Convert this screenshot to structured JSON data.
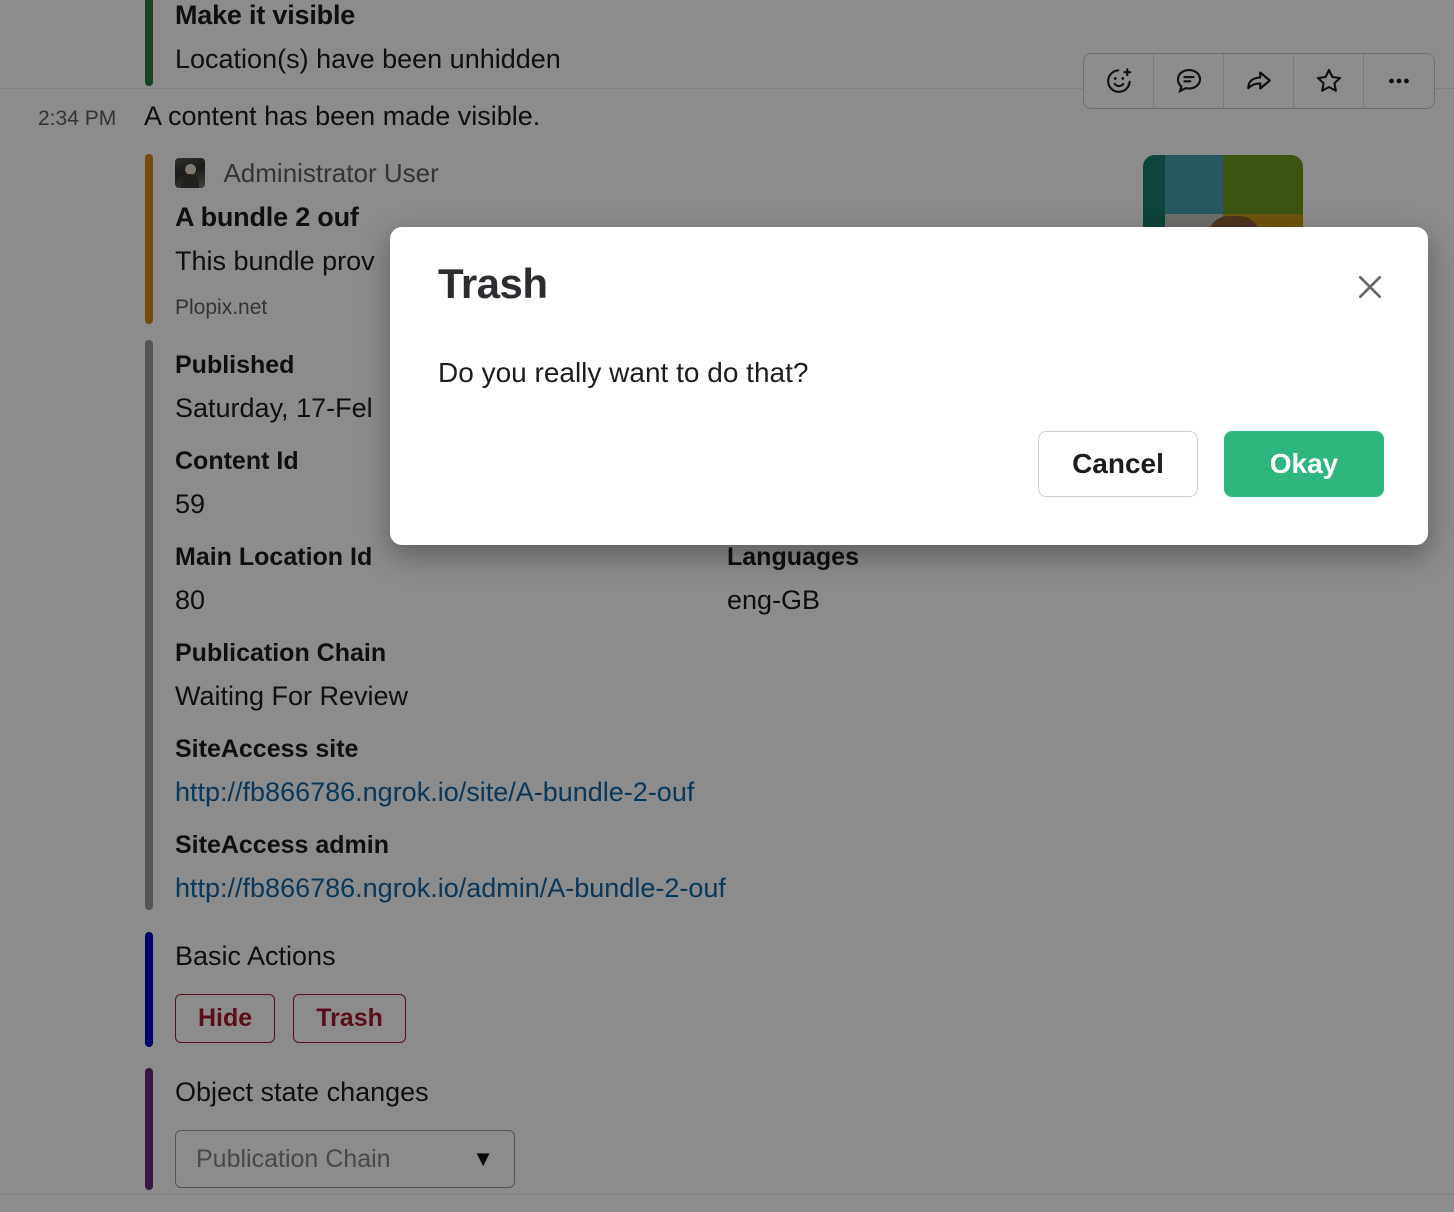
{
  "messages": {
    "unhidden_notice": {
      "title": "Make it visible",
      "text": "Location(s) have been unhidden",
      "accent_color": "#2a7a3b"
    },
    "system_line": {
      "timestamp": "2:34 PM",
      "text": "A content has been made visible."
    },
    "bundle_attachment": {
      "author": "Administrator User",
      "title": "A bundle 2 ouf",
      "description": "This bundle prov",
      "footer": "Plopix.net",
      "accent_color": "#d18b16"
    }
  },
  "details": {
    "accent_color": "#9a9a9a",
    "fields": [
      {
        "label": "Published",
        "value": "Saturday, 17-Fel"
      },
      {
        "label": "Content Id",
        "value": "59"
      },
      {
        "label": "Main Location Id",
        "value": "80"
      },
      {
        "label": "Languages",
        "value": "eng-GB"
      },
      {
        "label": "Publication Chain",
        "value": "Waiting For Review"
      },
      {
        "label": "SiteAccess site",
        "value": "http://fb866786.ngrok.io/site/A-bundle-2-ouf"
      },
      {
        "label": "SiteAccess admin",
        "value": "http://fb866786.ngrok.io/admin/A-bundle-2-ouf"
      }
    ],
    "link_color": "#1264a3"
  },
  "basic_actions": {
    "title": "Basic Actions",
    "accent_color": "#0000cc",
    "button_color": "#a61b2b",
    "buttons": [
      {
        "label": "Hide"
      },
      {
        "label": "Trash"
      }
    ]
  },
  "object_state_changes": {
    "title": "Object state changes",
    "accent_color": "#6b2d7e",
    "select": {
      "value": "Publication Chain",
      "caret": "chevron-down-icon"
    }
  },
  "hover_toolbar": {
    "items": [
      {
        "name": "add-reaction-icon",
        "label": "Add reaction"
      },
      {
        "name": "reply-in-thread-icon",
        "label": "Reply in thread"
      },
      {
        "name": "share-message-icon",
        "label": "Share message"
      },
      {
        "name": "save-message-icon",
        "label": "Save for later"
      },
      {
        "name": "more-actions-icon",
        "label": "More actions"
      }
    ]
  },
  "modal": {
    "title": "Trash",
    "body": "Do you really want to do that?",
    "close_icon": "close-icon",
    "cancel_label": "Cancel",
    "okay_label": "Okay",
    "okay_color": "#2eb67d"
  }
}
